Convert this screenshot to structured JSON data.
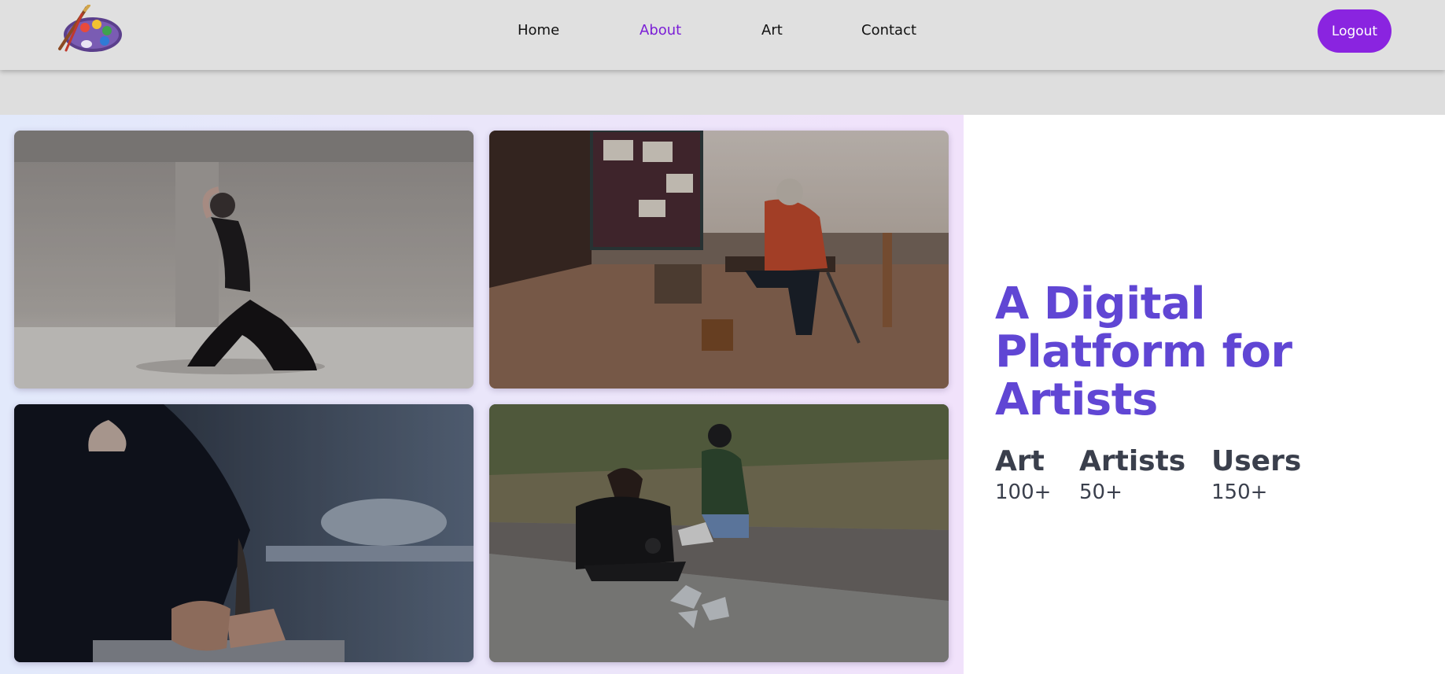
{
  "header": {
    "logo_icon": "artist-palette-icon",
    "nav": [
      {
        "label": "Home",
        "active": false
      },
      {
        "label": "About",
        "active": true
      },
      {
        "label": "Art",
        "active": false
      },
      {
        "label": "Contact",
        "active": false
      }
    ],
    "logout_label": "Logout"
  },
  "gallery": {
    "photos": [
      {
        "subject": "dancer kneeling in studio"
      },
      {
        "subject": "painter with easel outdoors"
      },
      {
        "subject": "sculptor shaping clay"
      },
      {
        "subject": "two artists sitting by roadside"
      }
    ]
  },
  "hero": {
    "title": "A Digital Platform for Artists",
    "stats": [
      {
        "label": "Art",
        "value": "100+"
      },
      {
        "label": "Artists",
        "value": "50+"
      },
      {
        "label": "Users",
        "value": "150+"
      }
    ]
  },
  "colors": {
    "accent": "#8a24e0",
    "title": "#6046d4",
    "active_nav": "#7b1fd6",
    "header_bg": "#e0e0e0"
  }
}
